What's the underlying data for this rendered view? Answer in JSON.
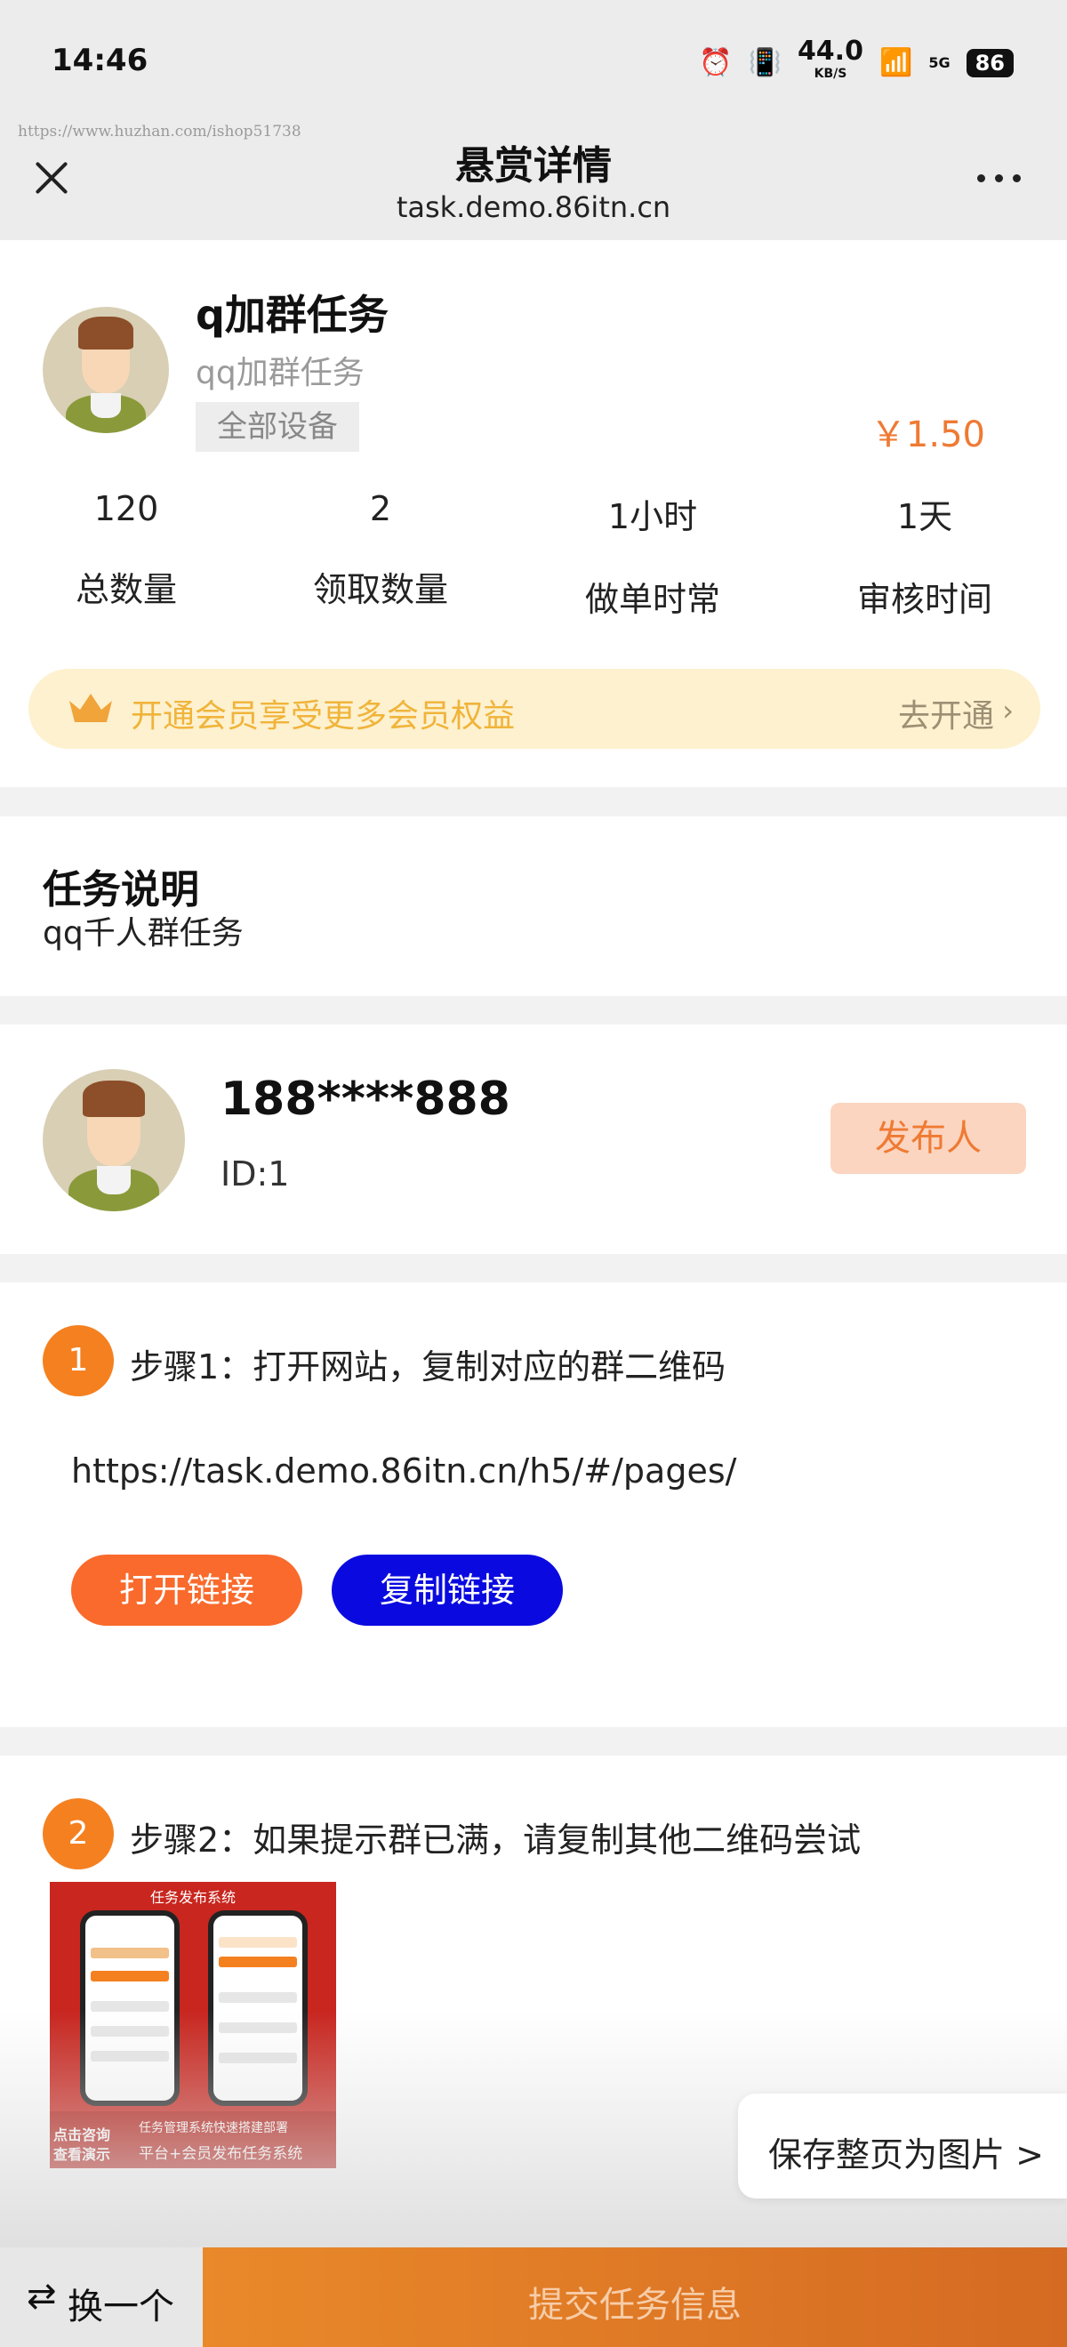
{
  "status_bar": {
    "time": "14:46",
    "network_speed": "44.0",
    "network_unit": "KB/S",
    "signal": "5G",
    "battery": "86"
  },
  "watermark": "https://www.huzhan.com/ishop51738",
  "header": {
    "title": "悬赏详情",
    "subtitle": "task.demo.86itn.cn"
  },
  "task": {
    "title": "q加群任务",
    "subtitle": "qq加群任务",
    "device_tag": "全部设备",
    "price": "￥1.50",
    "stats": [
      {
        "value": "120",
        "label": "总数量"
      },
      {
        "value": "2",
        "label": "领取数量"
      },
      {
        "value": "1小时",
        "label": "做单时常"
      },
      {
        "value": "1天",
        "label": "审核时间"
      }
    ]
  },
  "vip": {
    "text": "开通会员享受更多会员权益",
    "action": "去开通",
    "arrow": "›"
  },
  "description": {
    "title": "任务说明",
    "text": "qq千人群任务"
  },
  "publisher": {
    "name": "188****888",
    "id": "ID:1",
    "badge": "发布人"
  },
  "steps": [
    {
      "number": "1",
      "text": "步骤1：打开网站，复制对应的群二维码",
      "url": "https://task.demo.86itn.cn/h5/#/pages/",
      "open_label": "打开链接",
      "copy_label": "复制链接"
    },
    {
      "number": "2",
      "text": "步骤2：如果提示群已满，请复制其他二维码尝试",
      "image": {
        "title": "任务发布系统",
        "side_line1": "点击咨询",
        "side_line2": "查看演示",
        "banner": "任务管理系统快速搭建部署",
        "main": "平台+会员发布任务系统"
      }
    }
  ],
  "save_page": "保存整页为图片 >",
  "bottom_bar": {
    "swap_label": "换一个",
    "submit_label": "提交任务信息"
  },
  "colors": {
    "accent_orange": "#f58020",
    "price": "#ef7a33",
    "copy_button": "#0a0ae0",
    "vip_background": "#fdf1cf"
  },
  "icons": [
    "close-icon",
    "more-icon",
    "crown-icon",
    "chevron-right-icon",
    "swap-icon"
  ]
}
